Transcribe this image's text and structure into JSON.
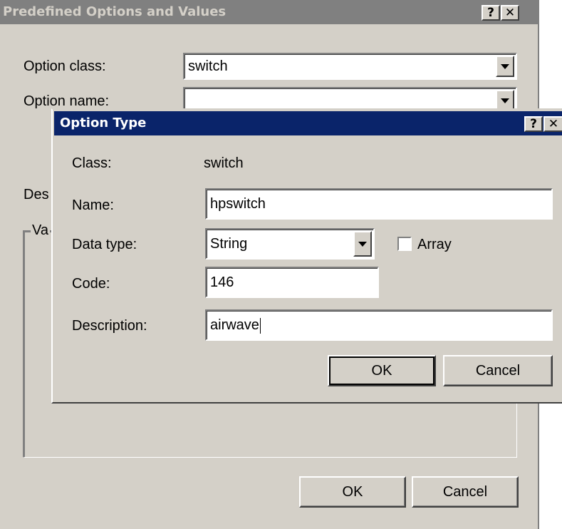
{
  "bg_dialog": {
    "title": "Predefined Options and Values",
    "help_label": "?",
    "close_label": "✕",
    "option_class_label": "Option class:",
    "option_class_value": "switch",
    "option_name_label": "Option name:",
    "option_name_value": "",
    "description_label_partial": "Des",
    "value_group_label_partial": "Va",
    "ok_label": "OK",
    "cancel_label": "Cancel"
  },
  "fg_dialog": {
    "title": "Option Type",
    "help_label": "?",
    "close_label": "✕",
    "class_label": "Class:",
    "class_value": "switch",
    "name_label": "Name:",
    "name_value": "hpswitch",
    "datatype_label": "Data type:",
    "datatype_value": "String",
    "array_label": "Array",
    "array_checked": false,
    "code_label": "Code:",
    "code_value": "146",
    "description_label": "Description:",
    "description_value": "airwave",
    "ok_label": "OK",
    "cancel_label": "Cancel"
  },
  "colors": {
    "inactive_titlebar": "#808080",
    "inactive_title_text": "#d4d0c8",
    "active_titlebar": "#0a246a",
    "active_title_text": "#ffffff",
    "dialog_face": "#d4d0c8"
  }
}
